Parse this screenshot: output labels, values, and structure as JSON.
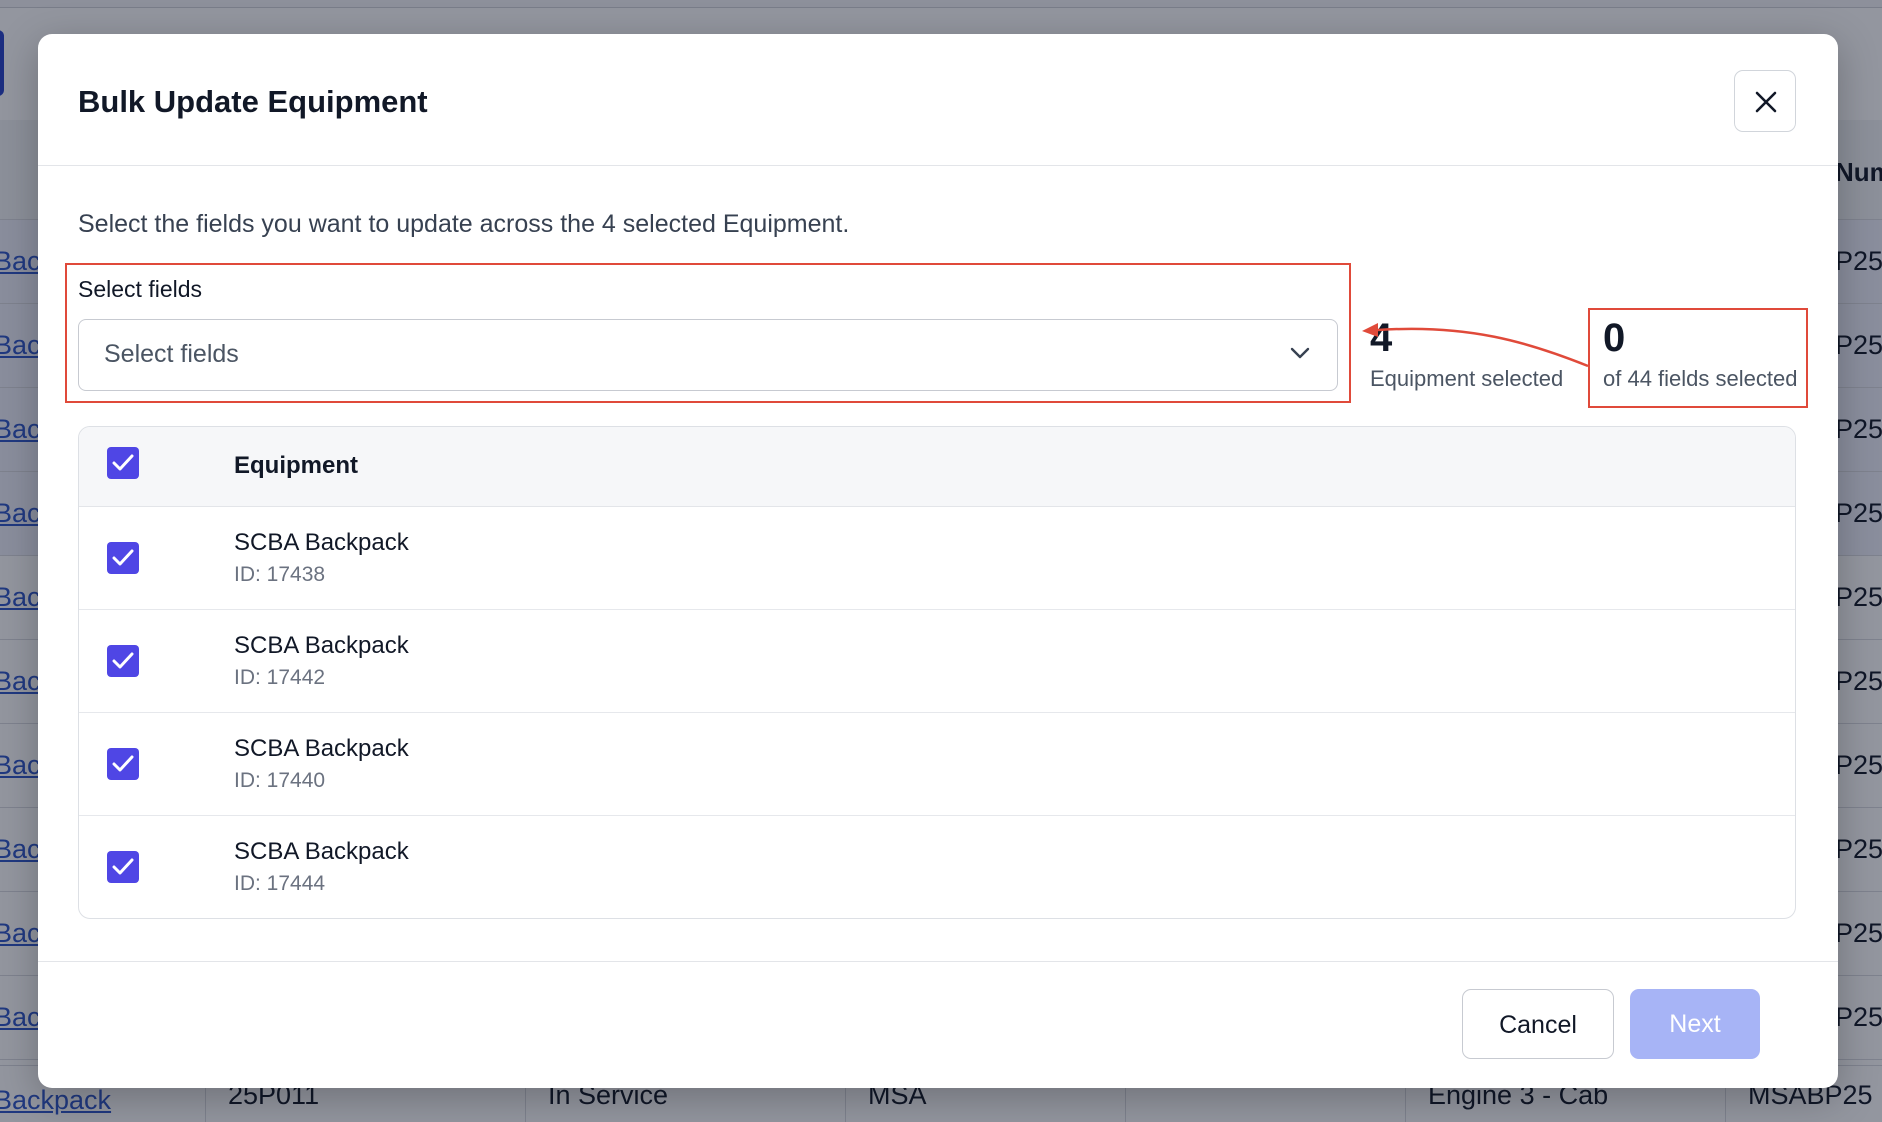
{
  "background": {
    "header_col": "Num",
    "link_text": "Bac",
    "link_text_full": "Backpack",
    "row_code": "P25",
    "last_row": {
      "id": "25P011",
      "status": "In Service",
      "make": "MSA",
      "location": "Engine 3 - Cab",
      "serial": "MSABP25"
    }
  },
  "modal": {
    "title": "Bulk Update Equipment",
    "close_icon": "close-icon",
    "intro": "Select the fields you want to update across the 4 selected Equipment.",
    "fields": {
      "label": "Select fields",
      "placeholder": "Select fields"
    },
    "stats": {
      "equipment_count": "4",
      "equipment_label": "Equipment selected",
      "fields_count": "0",
      "fields_label": "of 44 fields selected"
    },
    "table": {
      "header": "Equipment",
      "rows": [
        {
          "name": "SCBA Backpack",
          "id": "ID: 17438",
          "checked": true
        },
        {
          "name": "SCBA Backpack",
          "id": "ID: 17442",
          "checked": true
        },
        {
          "name": "SCBA Backpack",
          "id": "ID: 17440",
          "checked": true
        },
        {
          "name": "SCBA Backpack",
          "id": "ID: 17444",
          "checked": true
        }
      ]
    },
    "footer": {
      "cancel": "Cancel",
      "next": "Next"
    }
  },
  "colors": {
    "accent": "#4f46e5",
    "next_disabled": "#a7b4f6",
    "highlight": "#e04a3a"
  }
}
